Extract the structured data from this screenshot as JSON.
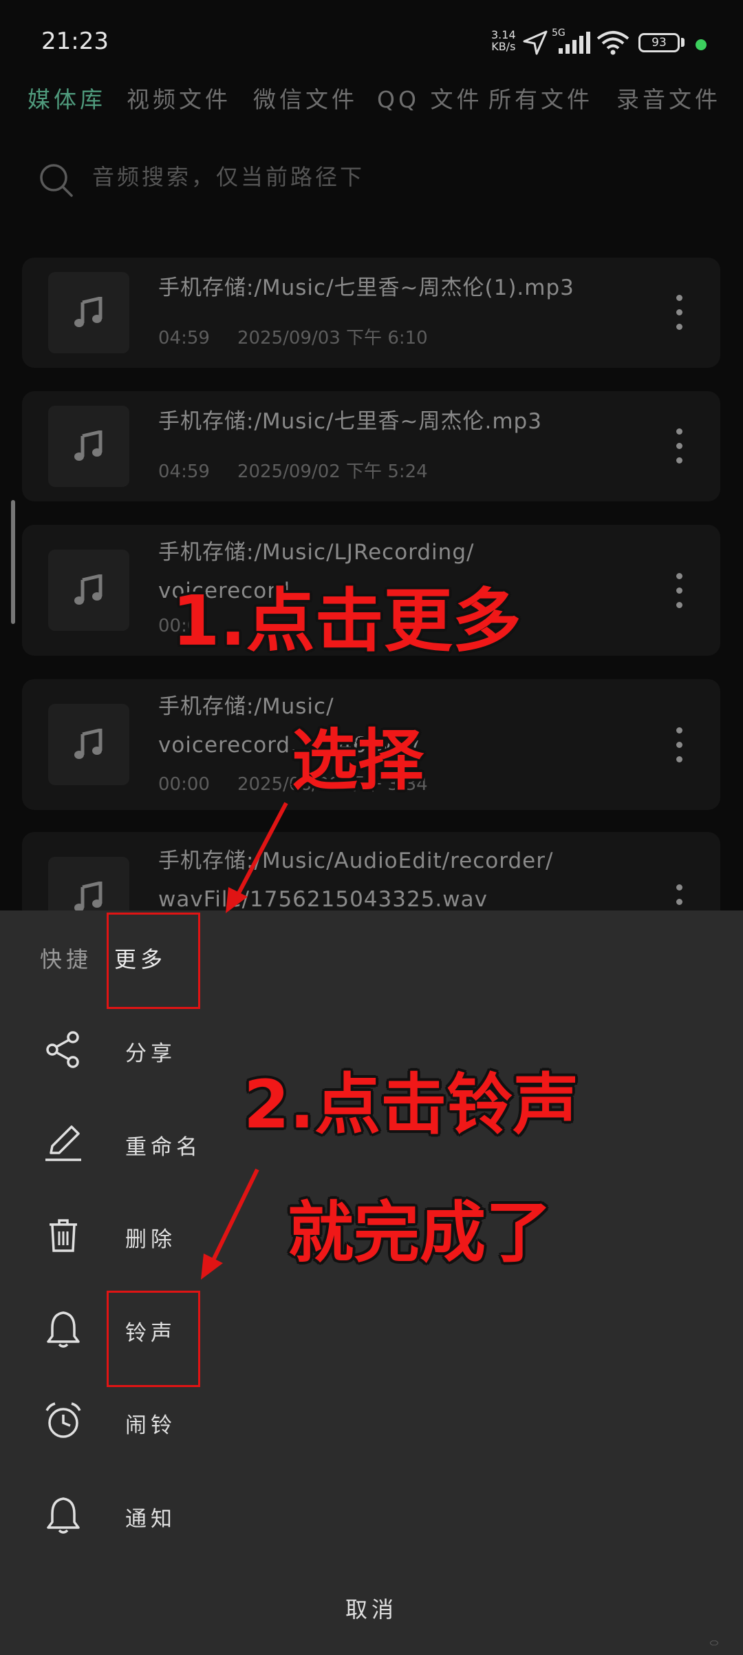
{
  "status_bar": {
    "time": "21:23",
    "net_speed_value": "3.14",
    "net_speed_unit": "KB/s",
    "network": "5G",
    "battery": "93"
  },
  "tabs": [
    "媒体库",
    "视频文件",
    "微信文件",
    "QQ 文件",
    "所有文件",
    "录音文件"
  ],
  "active_tab": 0,
  "search": {
    "placeholder": "音频搜索，仅当前路径下"
  },
  "files": [
    {
      "title": "手机存储:/Music/七里香~周杰伦(1).mp3",
      "duration": "04:59",
      "date": "2025/09/03 下午 6:10"
    },
    {
      "title": "手机存储:/Music/七里香~周杰伦.mp3",
      "duration": "04:59",
      "date": "2025/09/02 下午 5:24"
    },
    {
      "title": "手机存储:/Music/LJRecording/\nvoicerecord...",
      "duration": "00:0",
      "date": ""
    },
    {
      "title": "手机存储:/Music/\nvoicerecord...7_46.wav",
      "duration": "00:00",
      "date": "2025/08/28 下午 3:34"
    },
    {
      "title": "手机存储:/Music/AudioEdit/recorder/\nwavFile/1756215043325.wav",
      "duration": "",
      "date": ""
    }
  ],
  "sheet": {
    "tab_quick": "快捷",
    "tab_more": "更多",
    "items": [
      {
        "label": "分享",
        "icon": "share-icon"
      },
      {
        "label": "重命名",
        "icon": "pencil-icon"
      },
      {
        "label": "删除",
        "icon": "trash-icon"
      },
      {
        "label": "铃声",
        "icon": "bell-icon"
      },
      {
        "label": "闹铃",
        "icon": "alarm-clock-icon"
      },
      {
        "label": "通知",
        "icon": "bell-icon"
      }
    ],
    "cancel": "取消"
  },
  "annotations": {
    "step1_line1": "1.点击更多",
    "step1_line2": "选择",
    "step2_line1": "2.点击铃声",
    "step2_line2": "就完成了"
  },
  "colors": {
    "accent": "#4f9a7c",
    "annotation": "#f01818",
    "sheet_bg": "#2c2c2c"
  }
}
